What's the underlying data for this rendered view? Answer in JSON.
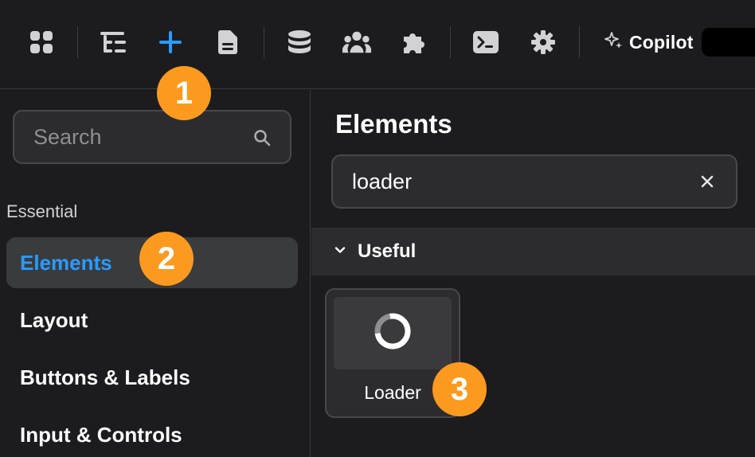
{
  "toolbar": {
    "icons": [
      {
        "name": "apps-grid-icon",
        "active": false
      },
      {
        "name": "outline-icon",
        "active": false
      },
      {
        "name": "add-icon",
        "active": true
      },
      {
        "name": "page-icon",
        "active": false
      },
      {
        "name": "database-icon",
        "active": false
      },
      {
        "name": "users-icon",
        "active": false
      },
      {
        "name": "plugins-icon",
        "active": false
      },
      {
        "name": "terminal-icon",
        "active": false
      },
      {
        "name": "settings-gear-icon",
        "active": false
      }
    ],
    "copilot_label": "Copilot",
    "accent_color": "#2a9bff",
    "icon_color": "#d1d1d6"
  },
  "left_panel": {
    "search": {
      "placeholder": "Search",
      "value": ""
    },
    "section_label": "Essential",
    "items": [
      {
        "label": "Elements",
        "active": true
      },
      {
        "label": "Layout",
        "active": false
      },
      {
        "label": "Buttons & Labels",
        "active": false
      },
      {
        "label": "Input & Controls",
        "active": false
      }
    ]
  },
  "right_panel": {
    "title": "Elements",
    "filter": {
      "value": "loader"
    },
    "group": {
      "label": "Useful",
      "expanded": true
    },
    "cards": [
      {
        "label": "Loader",
        "icon": "loader-spinner-icon"
      }
    ]
  },
  "badges": [
    {
      "label": "1",
      "target": "add-icon"
    },
    {
      "label": "2",
      "target": "elements-nav-item"
    },
    {
      "label": "3",
      "target": "loader-card"
    }
  ],
  "badge_color": "#fb9a1f"
}
